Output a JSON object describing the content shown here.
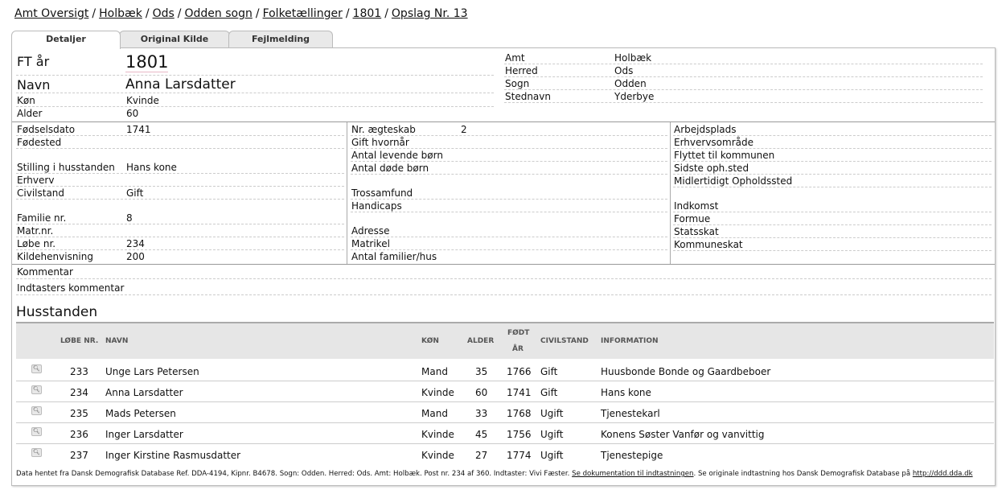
{
  "breadcrumb": [
    {
      "label": "Amt Oversigt"
    },
    {
      "label": "Holbæk"
    },
    {
      "label": "Ods"
    },
    {
      "label": "Odden sogn"
    },
    {
      "label": "Folketællinger"
    },
    {
      "label": "1801"
    },
    {
      "label": "Opslag Nr. 13"
    }
  ],
  "tabs": {
    "details": "Detaljer",
    "original": "Original Kilde",
    "error": "Fejlmelding"
  },
  "top": {
    "ft_label": "FT år",
    "ft_value": "1801",
    "name_label": "Navn",
    "name_value": "Anna Larsdatter",
    "gender_label": "Køn",
    "gender_value": "Kvinde",
    "age_label": "Alder",
    "age_value": "60",
    "amt_label": "Amt",
    "amt_value": "Holbæk",
    "herred_label": "Herred",
    "herred_value": "Ods",
    "sogn_label": "Sogn",
    "sogn_value": "Odden",
    "sted_label": "Stednavn",
    "sted_value": "Yderbye"
  },
  "col1": {
    "birthdate_label": "Fødselsdato",
    "birthdate_value": "1741",
    "birthplace_label": "Fødested",
    "position_label": "Stilling i husstanden",
    "position_value": "Hans kone",
    "occupation_label": "Erhverv",
    "civil_label": "Civilstand",
    "civil_value": "Gift",
    "family_label": "Familie nr.",
    "family_value": "8",
    "matr_label": "Matr.nr.",
    "lobe_label": "Løbe nr.",
    "lobe_value": "234",
    "source_label": "Kildehenvisning",
    "source_value": "200"
  },
  "col2": {
    "marriage_label": "Nr. ægteskab",
    "marriage_value": "2",
    "married_when_label": "Gift hvornår",
    "living_children_label": "Antal levende børn",
    "dead_children_label": "Antal døde børn",
    "religion_label": "Trossamfund",
    "handicap_label": "Handicaps",
    "address_label": "Adresse",
    "matrikel_label": "Matrikel",
    "families_label": "Antal familier/hus"
  },
  "col3": {
    "workplace_label": "Arbejdsplads",
    "business_label": "Erhvervsområde",
    "moved_label": "Flyttet til kommunen",
    "last_label": "Sidste oph.sted",
    "temp_label": "Midlertidigt Opholdssted",
    "income_label": "Indkomst",
    "wealth_label": "Formue",
    "state_tax_label": "Statsskat",
    "muni_tax_label": "Kommuneskat"
  },
  "comments": {
    "comment_label": "Kommentar",
    "indtaster_label": "Indtasters kommentar"
  },
  "household": {
    "title": "Husstanden",
    "headers": {
      "lobe": "LØBE NR.",
      "name": "NAVN",
      "gender": "KØN",
      "age": "ALDER",
      "born_1": "FØDT",
      "born_2": "ÅR",
      "civil": "CIVILSTAND",
      "info": "INFORMATION"
    },
    "rows": [
      {
        "lobe": "233",
        "name": "Unge Lars Petersen",
        "gender": "Mand",
        "age": "35",
        "born": "1766",
        "civil": "Gift",
        "info": "Huusbonde Bonde og Gaardbeboer"
      },
      {
        "lobe": "234",
        "name": "Anna Larsdatter",
        "gender": "Kvinde",
        "age": "60",
        "born": "1741",
        "civil": "Gift",
        "info": "Hans kone"
      },
      {
        "lobe": "235",
        "name": "Mads Petersen",
        "gender": "Mand",
        "age": "33",
        "born": "1768",
        "civil": "Ugift",
        "info": "Tjenestekarl"
      },
      {
        "lobe": "236",
        "name": "Inger Larsdatter",
        "gender": "Kvinde",
        "age": "45",
        "born": "1756",
        "civil": "Ugift",
        "info": "Konens Søster Vanfør og vanvittig"
      },
      {
        "lobe": "237",
        "name": "Inger Kirstine Rasmusdatter",
        "gender": "Kvinde",
        "age": "27",
        "born": "1774",
        "civil": "Ugift",
        "info": "Tjenestepige"
      }
    ]
  },
  "footer": {
    "text1": "Data hentet fra Dansk Demografisk Database Ref. DDA-4194, Kipnr. B4678. Sogn: Odden. Herred: Ods. Amt: Holbæk. Post nr. 234 af 360. Indtaster: Vivi Fæster. ",
    "link1": "Se dokumentation til indtastningen",
    "text2": ". Se originale indtastning hos Dansk Demografisk Database på ",
    "link2": "http://ddd.dda.dk"
  }
}
